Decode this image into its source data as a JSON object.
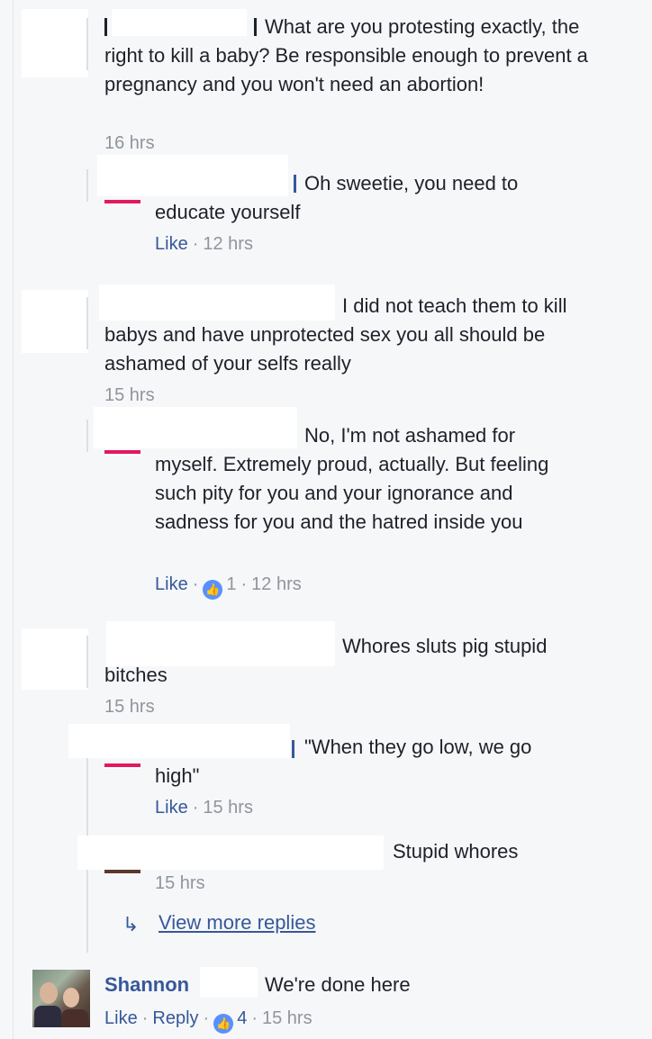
{
  "comments": [
    {
      "text": "What are you protesting exactly, the right to kill a baby? Be responsible enough to prevent a pregnancy and you won't need an abortion!",
      "time": "16 hrs",
      "replies": [
        {
          "text": "Oh sweetie, you need to educate yourself",
          "like": "Like",
          "time": "12 hrs"
        }
      ]
    },
    {
      "text": "I did not teach them to kill babys and have unprotected sex you all should be ashamed of your selfs really",
      "time": "15 hrs",
      "replies": [
        {
          "text": "No, I'm not ashamed for myself. Extremely proud, actually. But feeling such pity for you and your ignorance and sadness for you and the hatred inside you",
          "like": "Like",
          "reaction_count": "1",
          "time": "12 hrs"
        }
      ]
    },
    {
      "text": "Whores sluts pig stupid bitches",
      "time": "15 hrs",
      "replies": [
        {
          "text": "\"When they go low, we go high\"",
          "like": "Like",
          "time": "15 hrs"
        },
        {
          "text": "Stupid whores",
          "time": "15 hrs"
        }
      ],
      "view_more": "View more replies"
    }
  ],
  "last_comment": {
    "author": "Shannon",
    "text": "We're done here",
    "like": "Like",
    "reply": "Reply",
    "reaction_count": "4",
    "time": "15 hrs"
  },
  "icons": {
    "like_badge": "thumbs-up-icon",
    "reply_arrow": "reply-arrow-icon"
  },
  "colors": {
    "link": "#365899",
    "muted": "#90949c",
    "text": "#1d2129",
    "background": "#f6f7f9",
    "like_badge": "#5890ff",
    "avatar_accent": "#e2195f"
  }
}
